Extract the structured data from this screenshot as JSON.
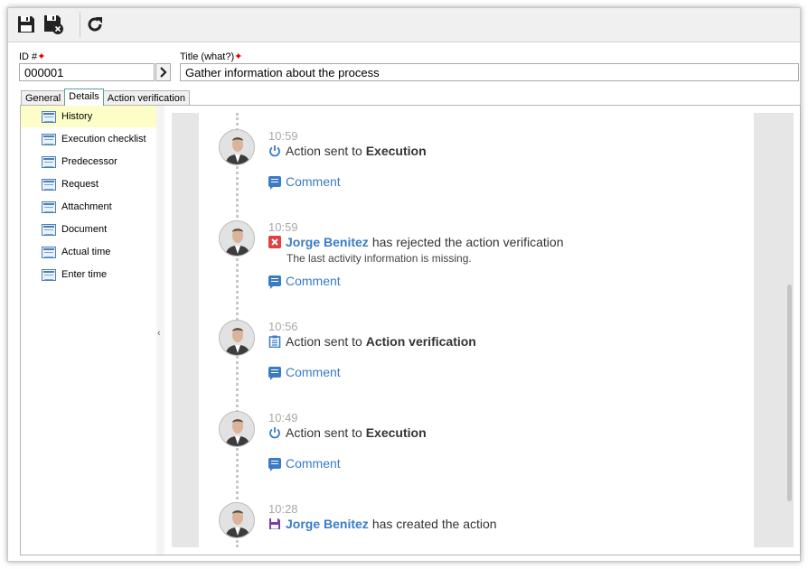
{
  "toolbar": {
    "save_icon": "floppy-disk-icon",
    "save_close_icon": "floppy-disk-close-icon",
    "refresh_icon": "refresh-icon"
  },
  "form": {
    "id_label": "ID #",
    "id_value": "000001",
    "title_label": "Title (what?)",
    "title_value": "Gather information about the process",
    "required_marker": "✦"
  },
  "tabs": [
    {
      "label": "General"
    },
    {
      "label": "Details"
    },
    {
      "label": "Action verification"
    }
  ],
  "sidebar": {
    "items": [
      {
        "label": "History"
      },
      {
        "label": "Execution checklist"
      },
      {
        "label": "Predecessor"
      },
      {
        "label": "Request"
      },
      {
        "label": "Attachment"
      },
      {
        "label": "Document"
      },
      {
        "label": "Actual time"
      },
      {
        "label": "Enter time"
      }
    ]
  },
  "splitter": {
    "arrow": "‹"
  },
  "timeline": {
    "entries": [
      {
        "time": "10:59",
        "icon": "power-icon",
        "prefix": "Action sent to",
        "target": "Execution",
        "comment": "Comment"
      },
      {
        "time": "10:59",
        "icon": "rejected-icon",
        "user": "Jorge Benitez",
        "text": "has rejected the action verification",
        "detail": "The last activity information is missing.",
        "comment": "Comment"
      },
      {
        "time": "10:56",
        "icon": "clipboard-icon",
        "prefix": "Action sent to",
        "target": "Action verification",
        "comment": "Comment"
      },
      {
        "time": "10:49",
        "icon": "power-icon",
        "prefix": "Action sent to",
        "target": "Execution",
        "comment": "Comment"
      },
      {
        "time": "10:28",
        "icon": "save-icon",
        "user": "Jorge Benitez",
        "text": "has created the action"
      }
    ]
  },
  "colors": {
    "accent": "#3a7cc4",
    "rejected": "#e04040",
    "created": "#7b3fa0",
    "selected_item": "#fdfdc8"
  }
}
